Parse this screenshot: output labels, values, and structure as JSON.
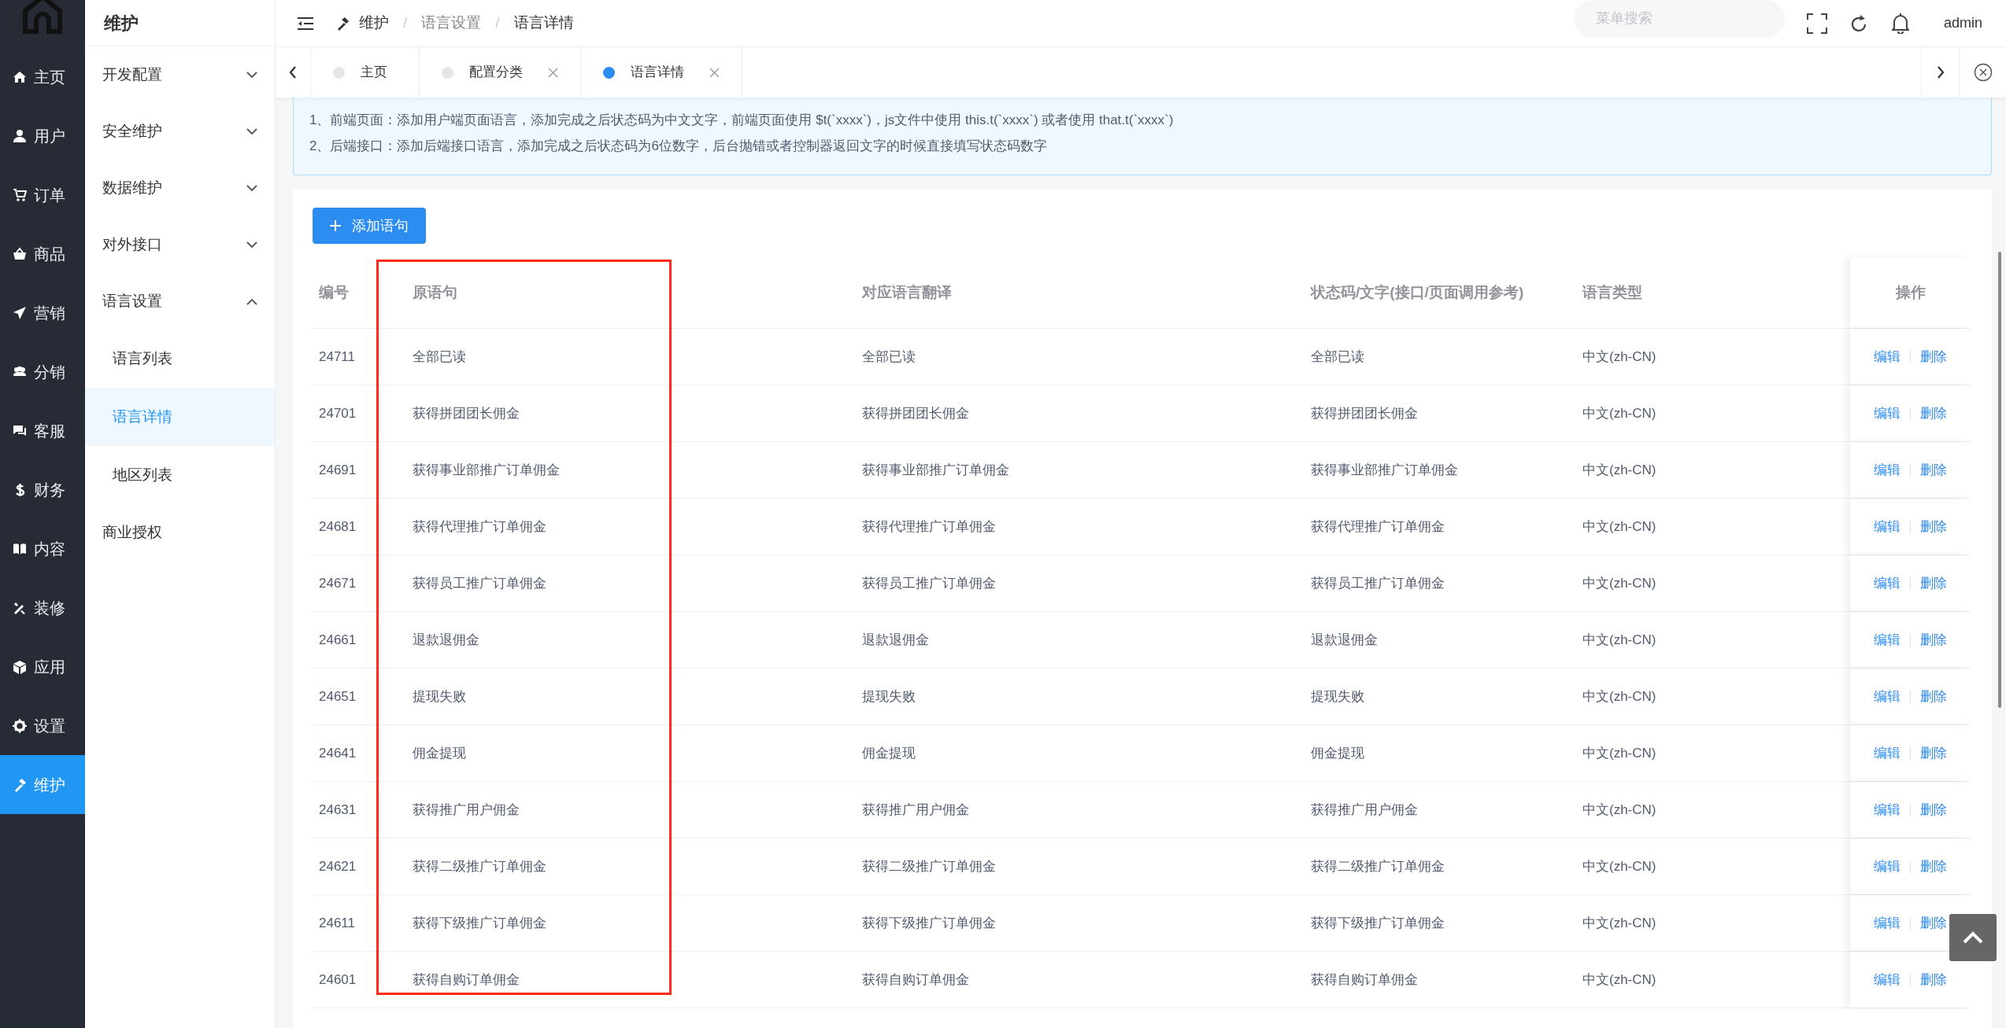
{
  "main_nav": [
    {
      "label": "主页",
      "selected": false
    },
    {
      "label": "用户",
      "selected": false
    },
    {
      "label": "订单",
      "selected": false
    },
    {
      "label": "商品",
      "selected": false
    },
    {
      "label": "营销",
      "selected": false
    },
    {
      "label": "分销",
      "selected": false
    },
    {
      "label": "客服",
      "selected": false
    },
    {
      "label": "财务",
      "selected": false
    },
    {
      "label": "内容",
      "selected": false
    },
    {
      "label": "装修",
      "selected": false
    },
    {
      "label": "应用",
      "selected": false
    },
    {
      "label": "设置",
      "selected": false
    },
    {
      "label": "维护",
      "selected": true
    }
  ],
  "sub_nav": {
    "title": "维护",
    "items": [
      {
        "label": "开发配置",
        "expanded": false,
        "selected": false
      },
      {
        "label": "安全维护",
        "expanded": false,
        "selected": false
      },
      {
        "label": "数据维护",
        "expanded": false,
        "selected": false
      },
      {
        "label": "对外接口",
        "expanded": false,
        "selected": false
      },
      {
        "label": "语言设置",
        "expanded": true,
        "selected": false,
        "children": [
          {
            "label": "语言列表",
            "selected": false
          },
          {
            "label": "语言详情",
            "selected": true
          },
          {
            "label": "地区列表",
            "selected": false
          }
        ]
      },
      {
        "label": "商业授权",
        "selected": false
      }
    ]
  },
  "header": {
    "breadcrumb": [
      "维护",
      "语言设置",
      "语言详情"
    ],
    "breadcrumb_separator": "/",
    "search": {
      "placeholder": "菜单搜索"
    },
    "user": "admin"
  },
  "tabs": [
    {
      "label": "主页",
      "selected": false,
      "closable": false
    },
    {
      "label": "配置分类",
      "selected": false,
      "closable": true
    },
    {
      "label": "语言详情",
      "selected": true,
      "closable": true
    }
  ],
  "notice": [
    "1、前端页面：添加用户端页面语言，添加完成之后状态码为中文文字，前端页面使用 $t(`xxxx`)，js文件中使用 this.t(`xxxx`) 或者使用 that.t(`xxxx`)",
    "2、后端接口：添加后端接口语言，添加完成之后状态码为6位数字，后台抛错或者控制器返回文字的时候直接填写状态码数字"
  ],
  "add_button": "添加语句",
  "table": {
    "columns": [
      "编号",
      "原语句",
      "对应语言翻译",
      "状态码/文字(接口/页面调用参考)",
      "语言类型",
      "操作"
    ],
    "rows": [
      {
        "id": "24711",
        "source": "全部已读",
        "translation": "全部已读",
        "code": "全部已读",
        "lang": "中文(zh-CN)",
        "actions": [
          "编辑",
          "删除"
        ]
      },
      {
        "id": "24701",
        "source": "获得拼团团长佣金",
        "translation": "获得拼团团长佣金",
        "code": "获得拼团团长佣金",
        "lang": "中文(zh-CN)",
        "actions": [
          "编辑",
          "删除"
        ]
      },
      {
        "id": "24691",
        "source": "获得事业部推广订单佣金",
        "translation": "获得事业部推广订单佣金",
        "code": "获得事业部推广订单佣金",
        "lang": "中文(zh-CN)",
        "actions": [
          "编辑",
          "删除"
        ]
      },
      {
        "id": "24681",
        "source": "获得代理推广订单佣金",
        "translation": "获得代理推广订单佣金",
        "code": "获得代理推广订单佣金",
        "lang": "中文(zh-CN)",
        "actions": [
          "编辑",
          "删除"
        ]
      },
      {
        "id": "24671",
        "source": "获得员工推广订单佣金",
        "translation": "获得员工推广订单佣金",
        "code": "获得员工推广订单佣金",
        "lang": "中文(zh-CN)",
        "actions": [
          "编辑",
          "删除"
        ]
      },
      {
        "id": "24661",
        "source": "退款退佣金",
        "translation": "退款退佣金",
        "code": "退款退佣金",
        "lang": "中文(zh-CN)",
        "actions": [
          "编辑",
          "删除"
        ]
      },
      {
        "id": "24651",
        "source": "提现失败",
        "translation": "提现失败",
        "code": "提现失败",
        "lang": "中文(zh-CN)",
        "actions": [
          "编辑",
          "删除"
        ]
      },
      {
        "id": "24641",
        "source": "佣金提现",
        "translation": "佣金提现",
        "code": "佣金提现",
        "lang": "中文(zh-CN)",
        "actions": [
          "编辑",
          "删除"
        ]
      },
      {
        "id": "24631",
        "source": "获得推广用户佣金",
        "translation": "获得推广用户佣金",
        "code": "获得推广用户佣金",
        "lang": "中文(zh-CN)",
        "actions": [
          "编辑",
          "删除"
        ]
      },
      {
        "id": "24621",
        "source": "获得二级推广订单佣金",
        "translation": "获得二级推广订单佣金",
        "code": "获得二级推广订单佣金",
        "lang": "中文(zh-CN)",
        "actions": [
          "编辑",
          "删除"
        ]
      },
      {
        "id": "24611",
        "source": "获得下级推广订单佣金",
        "translation": "获得下级推广订单佣金",
        "code": "获得下级推广订单佣金",
        "lang": "中文(zh-CN)",
        "actions": [
          "编辑",
          "删除"
        ]
      },
      {
        "id": "24601",
        "source": "获得自购订单佣金",
        "translation": "获得自购订单佣金",
        "code": "获得自购订单佣金",
        "lang": "中文(zh-CN)",
        "actions": [
          "编辑",
          "删除"
        ]
      }
    ]
  }
}
